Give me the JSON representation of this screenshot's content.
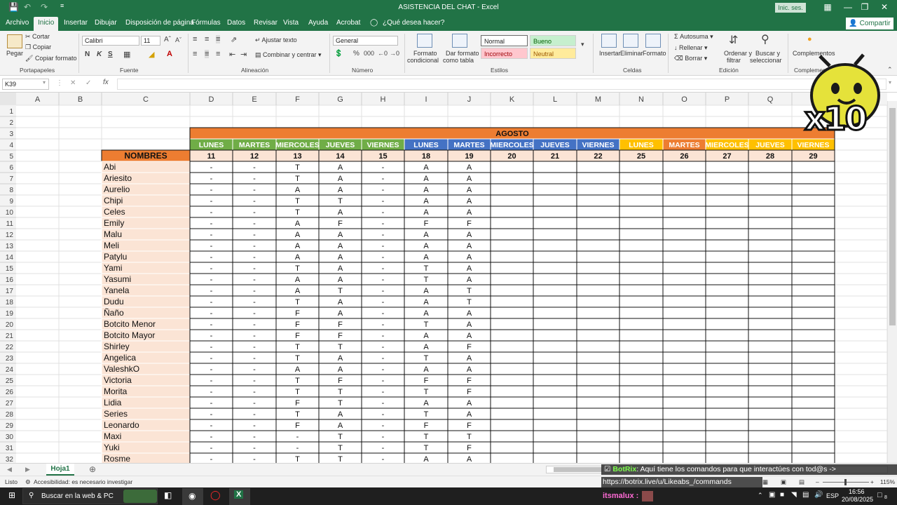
{
  "window": {
    "title": "ASISTENCIA DEL CHAT  -  Excel",
    "sign_in": "Inic. ses.",
    "share": "Compartir",
    "tell_me": "¿Qué desea hacer?"
  },
  "menu_tabs": [
    "Archivo",
    "Inicio",
    "Insertar",
    "Dibujar",
    "Disposición de página",
    "Fórmulas",
    "Datos",
    "Revisar",
    "Vista",
    "Ayuda",
    "Acrobat"
  ],
  "ribbon": {
    "paste": "Pegar",
    "cut": "Cortar",
    "copy": "Copiar",
    "format_painter": "Copiar formato",
    "clipboard_group": "Portapapeles",
    "font_name": "Calibri",
    "font_size": "11",
    "bold": "N",
    "italic": "K",
    "underline": "S",
    "font_group": "Fuente",
    "wrap_text": "Ajustar texto",
    "merge_center": "Combinar y centrar",
    "alignment_group": "Alineación",
    "number_format": "General",
    "number_group": "Número",
    "conditional_format": [
      "Formato",
      "condicional"
    ],
    "format_table": [
      "Dar formato",
      "como tabla"
    ],
    "styles_group": "Estilos",
    "styles": {
      "normal": "Normal",
      "good": "Bueno",
      "bad": "Incorrecto",
      "neutral": "Neutral"
    },
    "insert": "Insertar",
    "delete": "Eliminar",
    "format": "Formato",
    "cells_group": "Celdas",
    "autosum": "Autosuma",
    "fill": "Rellenar",
    "clear": "Borrar",
    "sort_filter": [
      "Ordenar y",
      "filtrar"
    ],
    "find_select": [
      "Buscar y",
      "seleccionar"
    ],
    "editing_group": "Edición",
    "addins": "Complementos",
    "addins_group": "Complementos"
  },
  "formula_bar": {
    "name_box": "K39",
    "fx": "fx",
    "value": ""
  },
  "columns": [
    "A",
    "B",
    "C",
    "D",
    "E",
    "F",
    "G",
    "H",
    "I",
    "J",
    "K",
    "L",
    "M",
    "N",
    "O",
    "P",
    "Q",
    "R"
  ],
  "rows": [
    "1",
    "2",
    "3",
    "4",
    "5",
    "6",
    "7",
    "8",
    "9",
    "10",
    "11",
    "12",
    "13",
    "14",
    "15",
    "16",
    "17",
    "18",
    "19",
    "20",
    "21",
    "22",
    "23",
    "24",
    "25",
    "26",
    "27",
    "28",
    "29",
    "30",
    "31",
    "32"
  ],
  "sheet": {
    "month": "AGOSTO",
    "names_header": "NOMBRES",
    "days": [
      "LUNES",
      "MARTES",
      "MIERCOLES",
      "JUEVES",
      "VIERNES",
      "LUNES",
      "MARTES",
      "MIERCOLES",
      "JUEVES",
      "VIERNES",
      "LUNES",
      "MARTES",
      "MIERCOLES",
      "JUEVES",
      "VIERNES"
    ],
    "dates": [
      "11",
      "12",
      "13",
      "14",
      "15",
      "18",
      "19",
      "20",
      "21",
      "22",
      "25",
      "26",
      "27",
      "28",
      "29"
    ],
    "day_colors": [
      "#70ad47",
      "#70ad47",
      "#70ad47",
      "#70ad47",
      "#70ad47",
      "#4472c4",
      "#4472c4",
      "#4472c4",
      "#4472c4",
      "#4472c4",
      "#ffc000",
      "#ed7d31",
      "#ffc000",
      "#ffc000",
      "#ffc000"
    ],
    "people": [
      {
        "name": "Abi",
        "marks": [
          "-",
          "-",
          "T",
          "A",
          "-",
          "A",
          "A"
        ]
      },
      {
        "name": "Ariesito",
        "marks": [
          "-",
          "-",
          "T",
          "A",
          "-",
          "A",
          "A"
        ]
      },
      {
        "name": "Aurelio",
        "marks": [
          "-",
          "-",
          "A",
          "A",
          "-",
          "A",
          "A"
        ]
      },
      {
        "name": "Chipi",
        "marks": [
          "-",
          "-",
          "T",
          "T",
          "-",
          "A",
          "A"
        ]
      },
      {
        "name": "Celes",
        "marks": [
          "-",
          "-",
          "T",
          "A",
          "-",
          "A",
          "A"
        ]
      },
      {
        "name": "Emily",
        "marks": [
          "-",
          "-",
          "A",
          "F",
          "-",
          "F",
          "F"
        ]
      },
      {
        "name": "Malu",
        "marks": [
          "-",
          "-",
          "A",
          "A",
          "-",
          "A",
          "A"
        ]
      },
      {
        "name": "Meli",
        "marks": [
          "-",
          "-",
          "A",
          "A",
          "-",
          "A",
          "A"
        ]
      },
      {
        "name": "Patylu",
        "marks": [
          "-",
          "-",
          "A",
          "A",
          "-",
          "A",
          "A"
        ]
      },
      {
        "name": "Yami",
        "marks": [
          "-",
          "-",
          "T",
          "A",
          "-",
          "T",
          "A"
        ]
      },
      {
        "name": "Yasumi",
        "marks": [
          "-",
          "-",
          "A",
          "A",
          "-",
          "T",
          "A"
        ]
      },
      {
        "name": "Yanela",
        "marks": [
          "-",
          "-",
          "A",
          "T",
          "-",
          "A",
          "T"
        ]
      },
      {
        "name": "Dudu",
        "marks": [
          "-",
          "-",
          "T",
          "A",
          "-",
          "A",
          "T"
        ]
      },
      {
        "name": "Ñaño",
        "marks": [
          "-",
          "-",
          "F",
          "A",
          "-",
          "A",
          "A"
        ]
      },
      {
        "name": "Botcito Menor",
        "marks": [
          "-",
          "-",
          "F",
          "F",
          "-",
          "T",
          "A"
        ]
      },
      {
        "name": "Botcito Mayor",
        "marks": [
          "-",
          "-",
          "F",
          "F",
          "-",
          "A",
          "A"
        ]
      },
      {
        "name": "Shirley",
        "marks": [
          "-",
          "-",
          "T",
          "T",
          "-",
          "A",
          "F"
        ]
      },
      {
        "name": "Angelica",
        "marks": [
          "-",
          "-",
          "T",
          "A",
          "-",
          "T",
          "A"
        ]
      },
      {
        "name": "ValeshkO",
        "marks": [
          "-",
          "-",
          "A",
          "A",
          "-",
          "A",
          "A"
        ]
      },
      {
        "name": "Victoria",
        "marks": [
          "-",
          "-",
          "T",
          "F",
          "-",
          "F",
          "F"
        ]
      },
      {
        "name": "Morita",
        "marks": [
          "-",
          "-",
          "T",
          "T",
          "-",
          "T",
          "F"
        ]
      },
      {
        "name": "Lidia",
        "marks": [
          "-",
          "-",
          "F",
          "T",
          "-",
          "A",
          "A"
        ]
      },
      {
        "name": "Series",
        "marks": [
          "-",
          "-",
          "T",
          "A",
          "-",
          "T",
          "A"
        ]
      },
      {
        "name": "Leonardo",
        "marks": [
          "-",
          "-",
          "F",
          "A",
          "-",
          "F",
          "F"
        ]
      },
      {
        "name": "Maxi",
        "marks": [
          "-",
          "-",
          "-",
          "T",
          "-",
          "T",
          "T"
        ]
      },
      {
        "name": "Yuki",
        "marks": [
          "-",
          "-",
          "-",
          "T",
          "-",
          "T",
          "F"
        ]
      },
      {
        "name": "Rosme",
        "marks": [
          "-",
          "-",
          "T",
          "T",
          "-",
          "A",
          "A"
        ]
      }
    ]
  },
  "sheet_tab": "Hoja1",
  "status": {
    "ready": "Listo",
    "accessibility": "Accesibilidad: es necesario investigar",
    "zoom": "115%"
  },
  "taskbar": {
    "search": "Buscar en la web & PC",
    "time": "16:56",
    "date": "20/08/2025",
    "lang": "ESP",
    "notif": "8"
  },
  "overlay": {
    "bot_name": "BotRix",
    "bot_message": ": Aquí tiene los comandos para que interactúes con tod@s ->",
    "url": "https://botrix.live/u/Likeabs_/commands",
    "user": "itsmalux :",
    "badge": "x10"
  }
}
